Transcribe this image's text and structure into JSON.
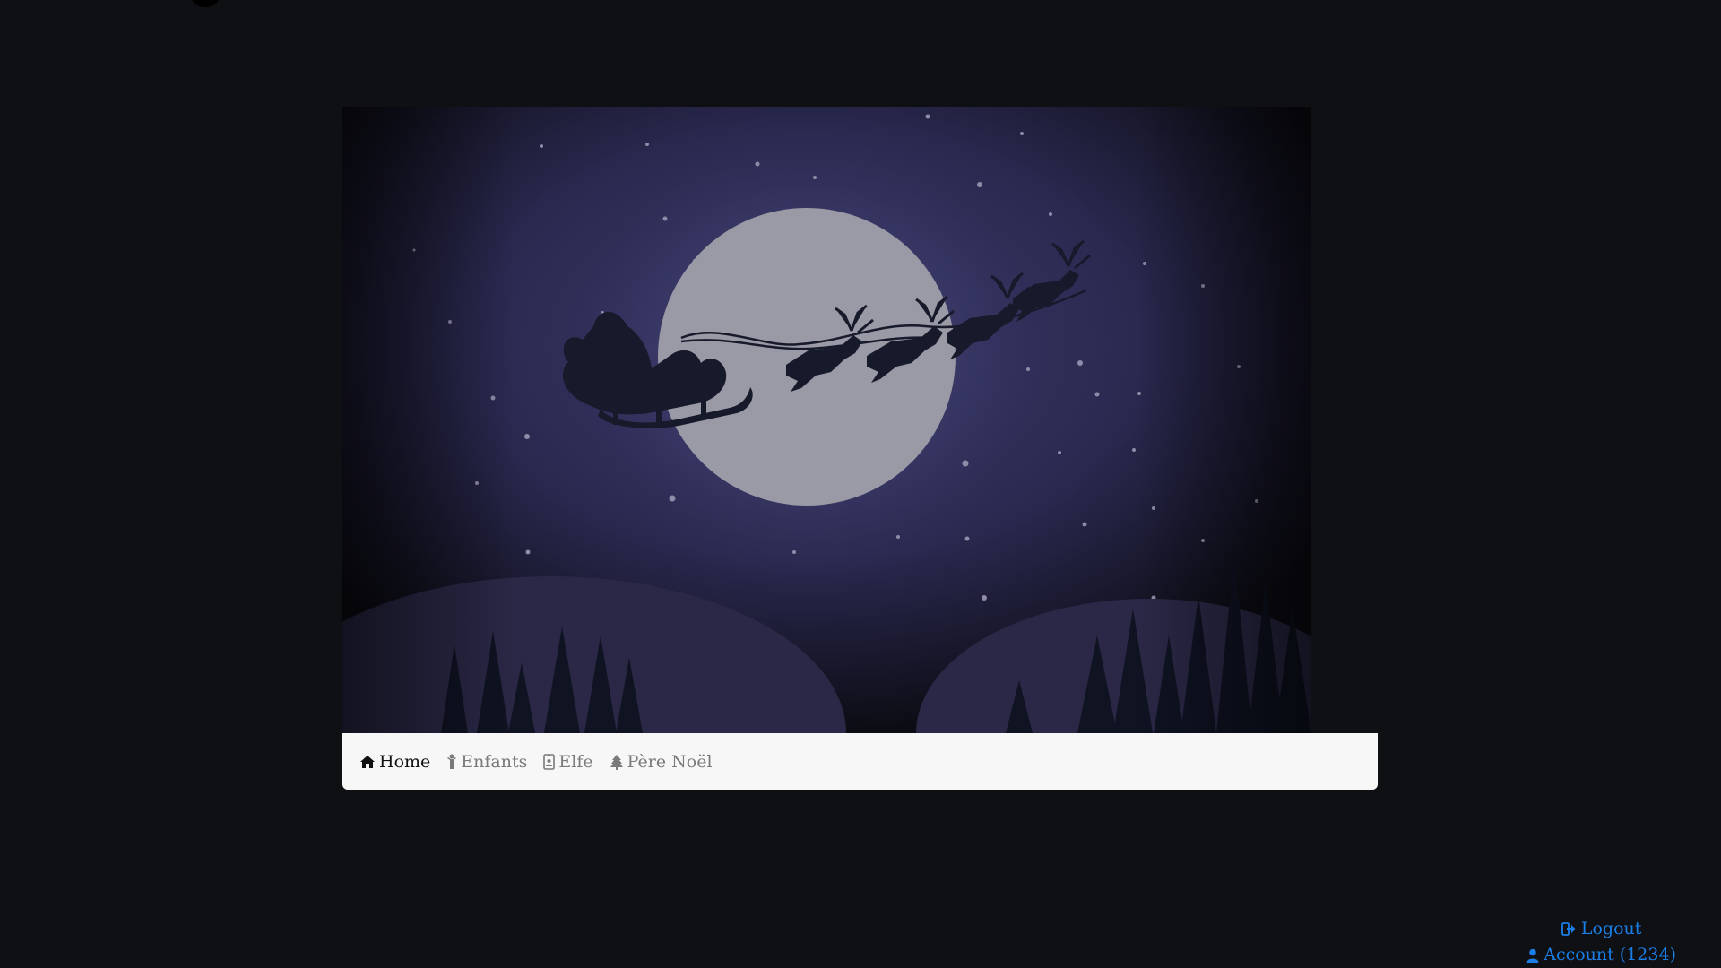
{
  "hero": {
    "image": "night-sky-santa-sleigh-moon"
  },
  "nav": {
    "items": [
      {
        "label": "Home",
        "icon": "home-icon",
        "active": true
      },
      {
        "label": "Enfants",
        "icon": "child-icon",
        "active": false
      },
      {
        "label": "Elfe",
        "icon": "badge-icon",
        "active": false
      },
      {
        "label": "Père Noël",
        "icon": "tree-icon",
        "active": false
      }
    ]
  },
  "account": {
    "logout_label": "Logout",
    "account_label": "Account (1234)"
  },
  "colors": {
    "background": "#0f1013",
    "navbar": "#f7f7f8",
    "link": "#1a7ee6",
    "sky": "#2e2d58"
  }
}
